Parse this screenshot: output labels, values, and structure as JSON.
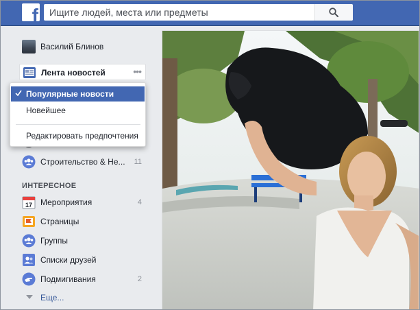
{
  "search": {
    "placeholder": "Ищите людей, места или предметы"
  },
  "sidebar": {
    "profile_name": "Василий Блинов",
    "news_feed_label": "Лента новостей",
    "news_feed_more": "•••",
    "items": [
      {
        "label": "Строительство & Не...",
        "count": "11",
        "icon": "group-icon"
      }
    ],
    "section_title": "ИНТЕРЕСНОЕ",
    "explore": [
      {
        "label": "Мероприятия",
        "count": "4",
        "icon": "calendar-icon"
      },
      {
        "label": "Страницы",
        "count": "",
        "icon": "flag-icon"
      },
      {
        "label": "Группы",
        "count": "",
        "icon": "groups-icon"
      },
      {
        "label": "Списки друзей",
        "count": "",
        "icon": "friends-list-icon"
      },
      {
        "label": "Подмигивания",
        "count": "2",
        "icon": "poke-icon"
      }
    ],
    "more_label": "Еще..."
  },
  "dropdown": {
    "options": [
      {
        "label": "Популярные новости",
        "selected": true
      },
      {
        "label": "Новейшее",
        "selected": false
      },
      {
        "label": "Редактировать предпочтения",
        "selected": false
      }
    ]
  },
  "colors": {
    "brand": "#4267b2",
    "link": "#365899",
    "background": "#e9ebee"
  }
}
